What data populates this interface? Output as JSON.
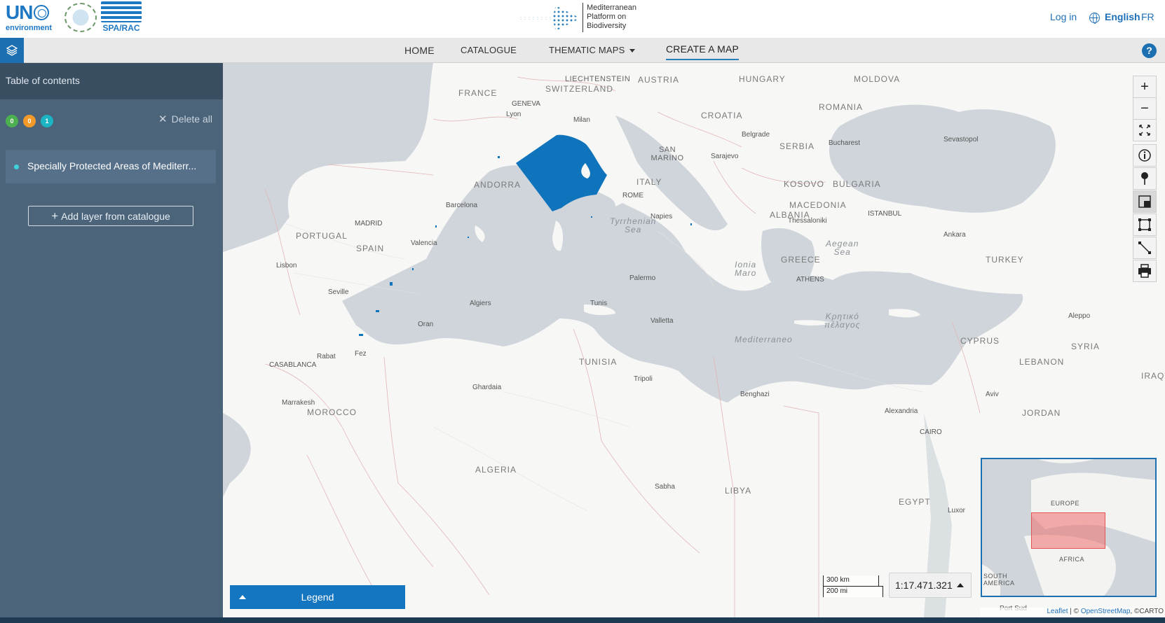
{
  "header": {
    "un_logo_text": "UN",
    "un_logo_sub": "environment",
    "spa_logo_text": "SPA/RAC",
    "platform_name": [
      "Mediterranean",
      "Platform on",
      "Biodiversity"
    ],
    "login_label": "Log in",
    "lang_en": "English",
    "lang_fr": "FR"
  },
  "nav": {
    "home": "HOME",
    "catalogue": "CATALOGUE",
    "thematic_maps": "THEMATIC MAPS",
    "create_map": "CREATE A MAP",
    "help": "?"
  },
  "sidebar": {
    "title": "Table of contents",
    "counts": {
      "green": "0",
      "orange": "0",
      "teal": "1"
    },
    "delete_all": "Delete all",
    "layers": [
      {
        "name": "Specially Protected Areas of Mediterr..."
      }
    ],
    "add_layer": "Add layer from catalogue"
  },
  "map": {
    "labels": {
      "countries": {
        "france": "FRANCE",
        "switzerland": "SWITZERLAND",
        "liechtenstein": "LIECHTENSTEIN",
        "austria": "AUSTRIA",
        "hungary": "HUNGARY",
        "moldova": "MOLDOVA",
        "croatia": "CROATIA",
        "romania": "ROMANIA",
        "san_marino": "SAN\nMARINO",
        "serbia": "SERBIA",
        "andorra": "ANDORRA",
        "italy": "ITALY",
        "kosovo": "KOSOVO",
        "bulgaria": "BULGARIA",
        "macedonia": "MACEDONIA",
        "albania": "ALBANIA",
        "portugal": "PORTUGAL",
        "spain": "SPAIN",
        "greece": "GREECE",
        "turkey": "TURKEY",
        "tunisia": "TUNISIA",
        "cyprus": "CYPRUS",
        "syria": "SYRIA",
        "lebanon": "LEBANON",
        "morocco": "MOROCCO",
        "algeria": "ALGERIA",
        "libya": "LIBYA",
        "egypt": "EGYPT",
        "jordan": "JORDAN",
        "iraq": "IRAQ"
      },
      "cities": {
        "geneva": "GENEVA",
        "lyon": "Lyon",
        "milan": "Milan",
        "belgrade": "Belgrade",
        "bucharest": "Bucharest",
        "sevastopol": "Sevastopol",
        "sarajevo": "Sarajevo",
        "barcelona": "Barcelona",
        "rome": "ROME",
        "madrid": "MADRID",
        "naples": "Napies",
        "thessaloniki": "Thessaloniki",
        "istanbul": "ISTANBUL",
        "ankara": "Ankara",
        "valencia": "Valencia",
        "lisbon": "Lisbon",
        "athens": "ATHENS",
        "palermo": "Palermo",
        "seville": "Seville",
        "algiers": "Algiers",
        "tunis": "Tunis",
        "oran": "Oran",
        "valletta": "Valletta",
        "aleppo": "Aleppo",
        "rabat": "Rabat",
        "fez": "Fez",
        "casablanca": "CASABLANCA",
        "tripoli": "Tripoli",
        "ghardaia": "Ghardaia",
        "marrakesh": "Marrakesh",
        "benghazi": "Benghazi",
        "aviv": "Aviv",
        "alexandria": "Alexandria",
        "cairo": "CAIRO",
        "sabha": "Sabha",
        "luxor": "Luxor",
        "port_sudan": "Port Sud"
      },
      "seas": {
        "tyrrhenian": "Tyrrhenian\nSea",
        "aegean": "Aegean\nSea",
        "ionian": "Ionia\nMaro",
        "mediterranean": "Mediterraneo",
        "kritiko": "Κρητικό\nπέλαγος"
      },
      "minimap": {
        "europe": "EUROPE",
        "africa": "AFRICA",
        "south_america": "SOUTH\nAMERICA"
      }
    },
    "controls": {
      "zoom_in": "+",
      "zoom_out": "−",
      "icons": [
        "fullscreen-icon",
        "info-icon",
        "marker-icon",
        "layer-swipe-icon",
        "area-measure-icon",
        "distance-measure-icon",
        "print-icon"
      ]
    },
    "scale": {
      "km": "300 km",
      "mi": "200 mi",
      "ratio": "1:17.471.321"
    },
    "legend_label": "Legend",
    "attribution": {
      "leaflet": "Leaflet",
      "sep": " | © ",
      "osm": "OpenStreetMap",
      "carto": ", ©CARTO"
    },
    "colors": {
      "sea": "#cfd5da",
      "land": "#f7f7f5",
      "protected_area": "#0f74bc",
      "accent": "#1c6fb0"
    }
  }
}
